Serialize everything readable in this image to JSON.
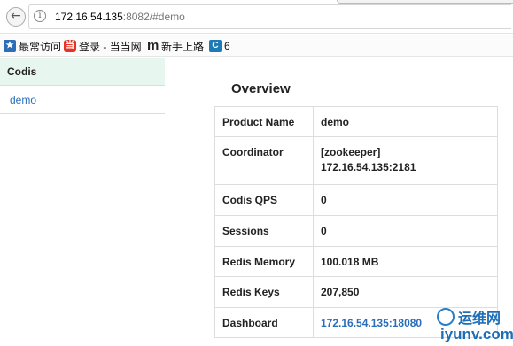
{
  "browser": {
    "url_host": "172.16.54.135",
    "url_rest": ":8082/#demo",
    "bookmarks": [
      {
        "icon": "bookmark-star-icon",
        "label": "最常访问"
      },
      {
        "icon": "dangdang-icon",
        "label": "登录 - 当当网"
      },
      {
        "icon": "m-logo-icon",
        "label": "新手上路"
      },
      {
        "icon": "c-logo-icon",
        "label": "6"
      }
    ]
  },
  "sidebar": {
    "title": "Codis",
    "items": [
      {
        "label": "demo"
      }
    ]
  },
  "overview": {
    "title": "Overview",
    "rows": [
      {
        "key": "Product Name",
        "value": "demo"
      },
      {
        "key": "Coordinator",
        "value": "[zookeeper]",
        "value2": "172.16.54.135:2181"
      },
      {
        "key": "Codis QPS",
        "value": "0"
      },
      {
        "key": "Sessions",
        "value": "0"
      },
      {
        "key": "Redis Memory",
        "value": "100.018 MB"
      },
      {
        "key": "Redis Keys",
        "value": "207,850"
      },
      {
        "key": "Dashboard",
        "value": "172.16.54.135:18080"
      }
    ]
  },
  "watermark": {
    "cn": "运维网",
    "en": "iyunv.com"
  }
}
